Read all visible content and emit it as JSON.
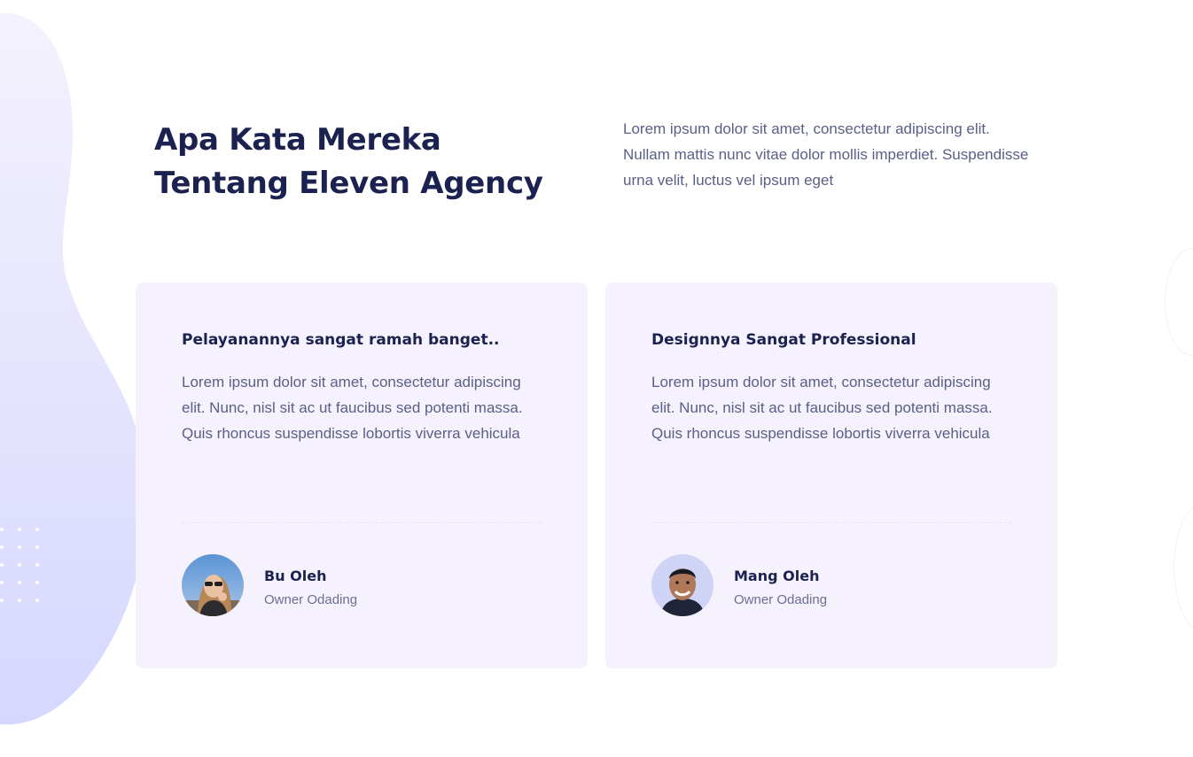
{
  "section": {
    "heading_line1": "Apa Kata Mereka",
    "heading_line2": "Tentang Eleven Agency",
    "intro": "Lorem ipsum dolor sit amet, consectetur adipiscing elit. Nullam mattis nunc vitae dolor mollis imperdiet. Suspendisse urna velit, luctus vel ipsum eget"
  },
  "testimonials": [
    {
      "title": "Pelayanannya sangat ramah banget..",
      "text": "Lorem ipsum dolor sit amet, consectetur adipiscing elit. Nunc, nisl sit ac ut faucibus sed potenti massa. Quis rhoncus suspendisse lobortis viverra vehicula",
      "author_name": "Bu Oleh",
      "author_role": "Owner Odading"
    },
    {
      "title": "Designnya Sangat Professional",
      "text": "Lorem ipsum dolor sit amet, consectetur adipiscing elit. Nunc, nisl sit ac ut faucibus sed potenti massa. Quis rhoncus suspendisse lobortis viverra vehicula",
      "author_name": "Mang Oleh",
      "author_role": "Owner Odading"
    }
  ],
  "colors": {
    "heading": "#1b2250",
    "body_text": "#5a5f87",
    "card_bg": "#f5f2fd",
    "blob_top": "#f3f1fd",
    "blob_bottom": "#d9daff"
  }
}
